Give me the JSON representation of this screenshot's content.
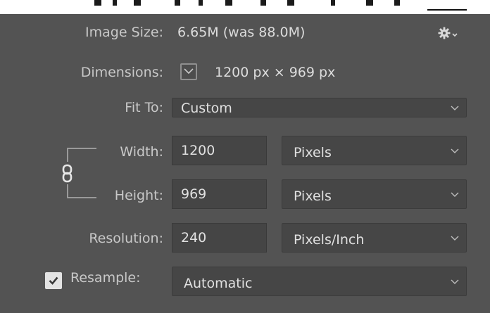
{
  "dialog": {
    "image_size": {
      "label": "Image Size:",
      "value": "6.65M (was 88.0M)"
    },
    "settings_icon": "gear-icon",
    "dimensions": {
      "label": "Dimensions:",
      "value": "1200 px  ×  969 px"
    },
    "fit_to": {
      "label": "Fit To:",
      "value": "Custom"
    },
    "width": {
      "label": "Width:",
      "value": "1200",
      "unit": "Pixels"
    },
    "height": {
      "label": "Height:",
      "value": "969",
      "unit": "Pixels"
    },
    "resolution": {
      "label": "Resolution:",
      "value": "240",
      "unit": "Pixels/Inch"
    },
    "resample": {
      "label": "Resample:",
      "checked": true,
      "method": "Automatic"
    },
    "constrain_icon": "chain-link-icon",
    "colors": {
      "background": "#535353",
      "field": "#454545",
      "text": "#dcdcdc"
    }
  }
}
